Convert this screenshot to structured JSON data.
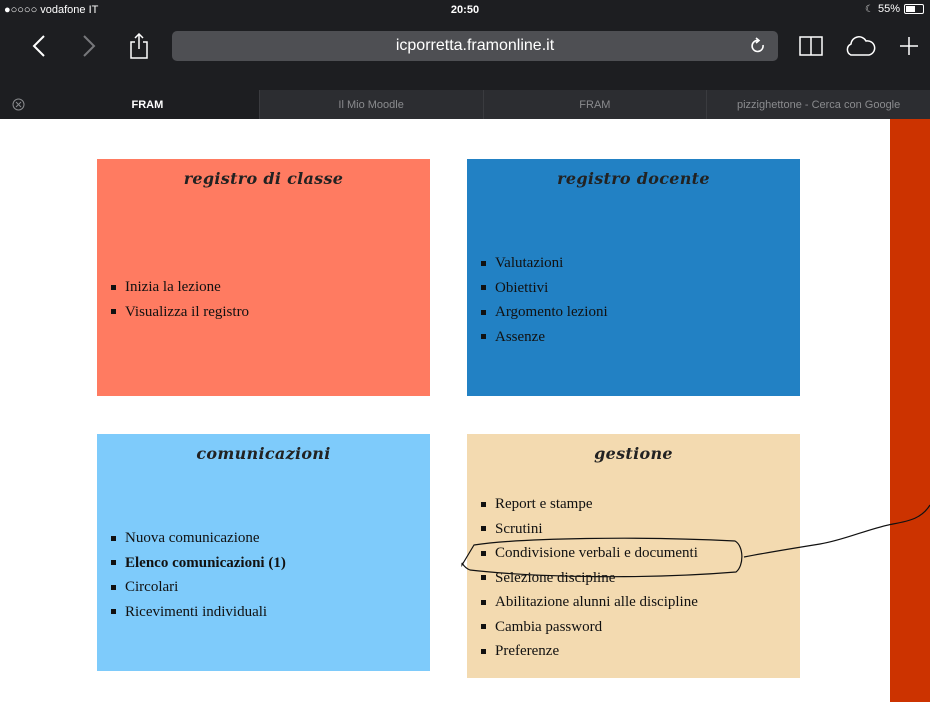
{
  "status": {
    "carrier": "●○○○○ vodafone IT",
    "time": "20:50",
    "battery": "55%",
    "battery_level": 0.55
  },
  "nav": {
    "url": "icporretta.framonline.it"
  },
  "tabs": [
    {
      "label": "FRAM",
      "active": true
    },
    {
      "label": "Il Mio Moodle",
      "active": false
    },
    {
      "label": "FRAM",
      "active": false
    },
    {
      "label": "pizzighettone - Cerca con Google",
      "active": false
    }
  ],
  "panels": {
    "registro_classe": {
      "title": "registro di classe",
      "items": [
        "Inizia la lezione",
        "Visualizza il registro"
      ]
    },
    "registro_docente": {
      "title": "registro docente",
      "items": [
        "Valutazioni",
        "Obiettivi",
        "Argomento lezioni",
        "Assenze"
      ]
    },
    "comunicazioni": {
      "title": "comunicazioni",
      "items": [
        "Nuova comunicazione",
        "Elenco comunicazioni (1)",
        "Circolari",
        "Ricevimenti individuali"
      ]
    },
    "gestione": {
      "title": "gestione",
      "items": [
        "Report e stampe",
        "Scrutini",
        "Condivisione verbali e documenti",
        "Selezione discipline",
        "Abilitazione alunni alle discipline",
        "Cambia password",
        "Preferenze"
      ]
    }
  },
  "colors": {
    "registro_classe": "#ff7b61",
    "registro_docente": "#2281c4",
    "comunicazioni": "#7ecbfb",
    "gestione": "#f3dab0",
    "side_stripe": "#cc3300"
  }
}
